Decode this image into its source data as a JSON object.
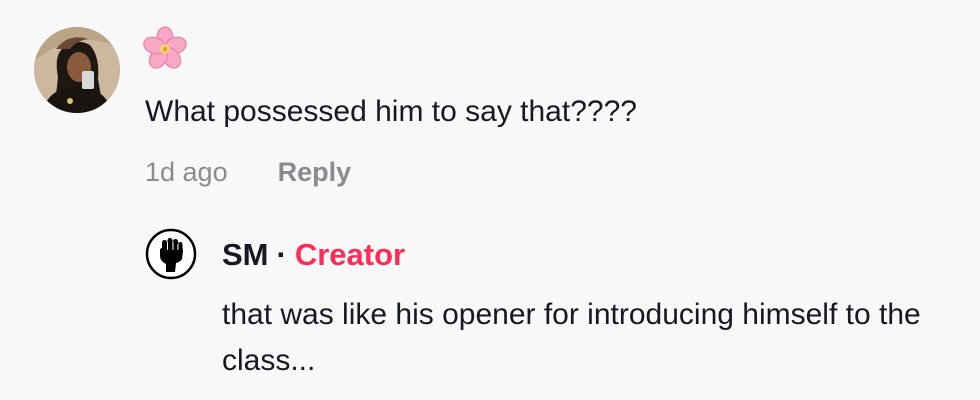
{
  "comment": {
    "username_icon": "cherry-blossom-icon",
    "text": "What possessed him to say that????",
    "timestamp": "1d ago",
    "reply_label": "Reply"
  },
  "reply": {
    "avatar_icon": "raised-fist-icon",
    "author": "SM",
    "separator": "·",
    "badge": "Creator",
    "text": "that was like his opener for introducing himself to the class..."
  },
  "colors": {
    "background": "#f8f8f8",
    "text": "#161823",
    "muted": "#8a8b91",
    "creator_badge": "#fe2c55"
  }
}
